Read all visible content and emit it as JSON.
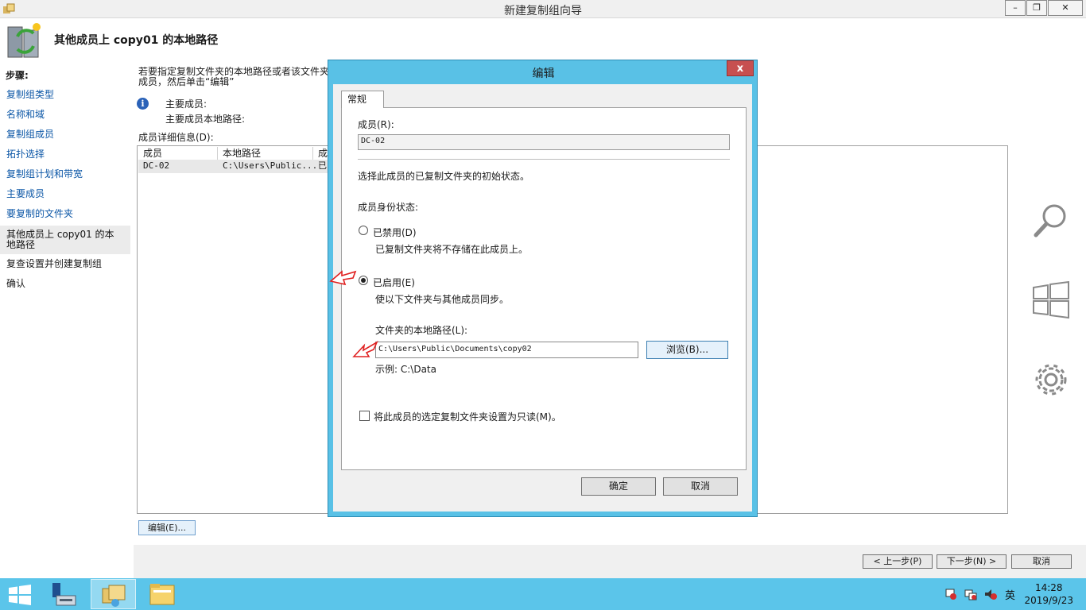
{
  "window": {
    "title": "新建复制组向导",
    "minimize": "–",
    "maximize": "❐",
    "close": "✕"
  },
  "header": {
    "title": "其他成员上 copy01 的本地路径"
  },
  "steps": {
    "label": "步骤:",
    "items": [
      {
        "label": "复制组类型"
      },
      {
        "label": "名称和域"
      },
      {
        "label": "复制组成员"
      },
      {
        "label": "拓扑选择"
      },
      {
        "label": "复制组计划和带宽"
      },
      {
        "label": "主要成员"
      },
      {
        "label": "要复制的文件夹"
      },
      {
        "label": "其他成员上 copy01 的本地路径"
      },
      {
        "label": "复查设置并创建复制组"
      },
      {
        "label": "确认"
      }
    ]
  },
  "main": {
    "description_line1": "若要指定复制文件夹的本地路径或者该文件夹",
    "description_line2": "成员，然后单击“编辑”",
    "info_primary_member": "主要成员:",
    "info_primary_path": "主要成员本地路径:",
    "details_label": "成员详细信息(D):",
    "columns": [
      "成员",
      "本地路径",
      "成"
    ],
    "rows": [
      {
        "member": "DC-02",
        "path": "C:\\Users\\Public...",
        "status": "已"
      }
    ],
    "edit_button": "编辑(E)..."
  },
  "nav": {
    "prev": "< 上一步(P)",
    "next": "下一步(N) >",
    "cancel": "取消"
  },
  "dialog": {
    "title": "编辑",
    "close": "x",
    "tab": "常规",
    "member_label": "成员(R):",
    "member_value": "DC-02",
    "state_desc": "选择此成员的已复制文件夹的初始状态。",
    "status_label": "成员身份状态:",
    "disabled_label": "已禁用(D)",
    "disabled_desc": "已复制文件夹将不存储在此成员上。",
    "enabled_label": "已启用(E)",
    "enabled_desc": "使以下文件夹与其他成员同步。",
    "path_label": "文件夹的本地路径(L):",
    "path_value": "C:\\Users\\Public\\Documents\\copy02",
    "browse_button": "浏览(B)...",
    "example": "示例: C:\\Data",
    "readonly_label": "将此成员的选定复制文件夹设置为只读(M)。",
    "ok": "确定",
    "cancel": "取消"
  },
  "taskbar": {
    "time": "14:28",
    "date": "2019/9/23",
    "ime": "英"
  }
}
